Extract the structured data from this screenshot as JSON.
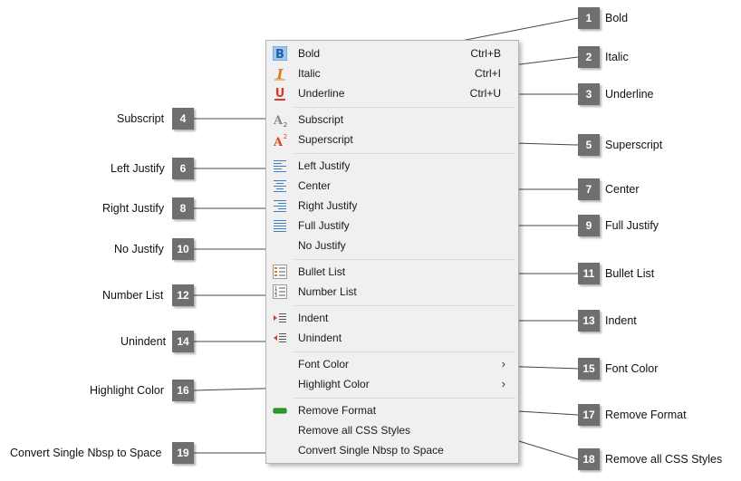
{
  "menu": {
    "bold": {
      "label": "Bold",
      "shortcut": "Ctrl+B",
      "icon": "bold-icon"
    },
    "italic": {
      "label": "Italic",
      "shortcut": "Ctrl+I",
      "icon": "italic-icon"
    },
    "underline": {
      "label": "Underline",
      "shortcut": "Ctrl+U",
      "icon": "underline-icon"
    },
    "subscript": {
      "label": "Subscript",
      "icon": "subscript-icon"
    },
    "superscript": {
      "label": "Superscript",
      "icon": "superscript-icon"
    },
    "left_justify": {
      "label": "Left Justify",
      "icon": "align-left-icon"
    },
    "center": {
      "label": "Center",
      "icon": "align-center-icon"
    },
    "right_justify": {
      "label": "Right Justify",
      "icon": "align-right-icon"
    },
    "full_justify": {
      "label": "Full Justify",
      "icon": "align-justify-icon"
    },
    "no_justify": {
      "label": "No Justify"
    },
    "bullet_list": {
      "label": "Bullet List",
      "icon": "bullet-list-icon"
    },
    "number_list": {
      "label": "Number List",
      "icon": "number-list-icon"
    },
    "indent": {
      "label": "Indent",
      "icon": "indent-icon"
    },
    "unindent": {
      "label": "Unindent",
      "icon": "unindent-icon"
    },
    "font_color": {
      "label": "Font Color",
      "arrow": "›"
    },
    "highlight_color": {
      "label": "Highlight Color",
      "arrow": "›"
    },
    "remove_format": {
      "label": "Remove Format",
      "icon": "remove-format-icon"
    },
    "remove_css": {
      "label": "Remove all CSS Styles"
    },
    "convert_nbsp": {
      "label": "Convert Single Nbsp to Space"
    }
  },
  "callouts": [
    {
      "num": "1",
      "text": "Bold"
    },
    {
      "num": "2",
      "text": "Italic"
    },
    {
      "num": "3",
      "text": "Underline"
    },
    {
      "num": "4",
      "text": "Subscript"
    },
    {
      "num": "5",
      "text": "Superscript"
    },
    {
      "num": "6",
      "text": "Left Justify"
    },
    {
      "num": "7",
      "text": "Center"
    },
    {
      "num": "8",
      "text": "Right Justify"
    },
    {
      "num": "9",
      "text": "Full Justify"
    },
    {
      "num": "10",
      "text": "No Justify"
    },
    {
      "num": "11",
      "text": "Bullet List"
    },
    {
      "num": "12",
      "text": "Number List"
    },
    {
      "num": "13",
      "text": "Indent"
    },
    {
      "num": "14",
      "text": "Unindent"
    },
    {
      "num": "15",
      "text": "Font Color"
    },
    {
      "num": "16",
      "text": "Highlight Color"
    },
    {
      "num": "17",
      "text": "Remove Format"
    },
    {
      "num": "18",
      "text": "Remove all CSS Styles"
    },
    {
      "num": "19",
      "text": "Convert Single Nbsp to Space"
    }
  ],
  "colors": {
    "badge": "#6f6f6f",
    "menu_bg": "#f0f0f0",
    "bold_icon_bg": "#9ec8f0",
    "format_icon": "#d84a1b",
    "list_icon": "#3b7fc4",
    "remove_icon": "#2aa02a"
  }
}
